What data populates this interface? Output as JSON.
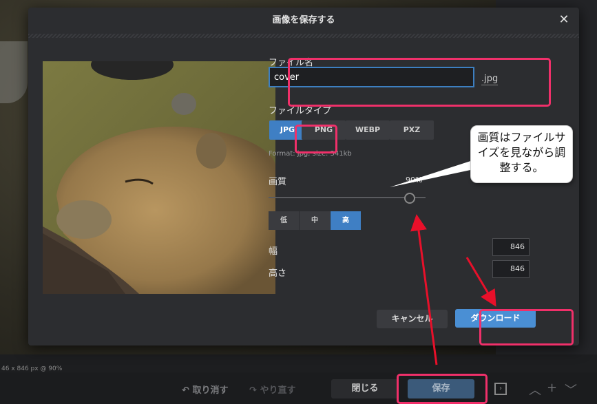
{
  "status_bar": {
    "text": "46 x 846 px @ 90%"
  },
  "bottom_bar": {
    "undo_label": "取り消す",
    "redo_label": "やり直す",
    "close_label": "閉じる",
    "save_label": "保存"
  },
  "dialog": {
    "title": "画像を保存する",
    "filename_label": "ファイル名",
    "filename_value": "cover",
    "extension": ".jpg",
    "filetype_label": "ファイルタイプ",
    "filetypes": [
      "JPG",
      "PNG",
      "WEBP",
      "PXZ"
    ],
    "selected_filetype": "JPG",
    "format_info": "Format: jpg, size: 341kb",
    "quality_label": "画質",
    "quality_value": "90%",
    "quality_fraction": 0.9,
    "quality_presets": [
      "低",
      "中",
      "高"
    ],
    "selected_preset": "高",
    "width_label": "幅",
    "width_value": "846",
    "height_label": "高さ",
    "height_value": "846",
    "cancel_label": "キャンセル",
    "download_label": "ダウンロード"
  },
  "annotation": {
    "callout_text": "画質はファイルサイズを見ながら調整する。",
    "highlight_color": "#f0306a",
    "arrow_color": "#e8102a"
  },
  "colors": {
    "accent": "#3f7fc4",
    "dialog_bg": "#2c2d30"
  }
}
